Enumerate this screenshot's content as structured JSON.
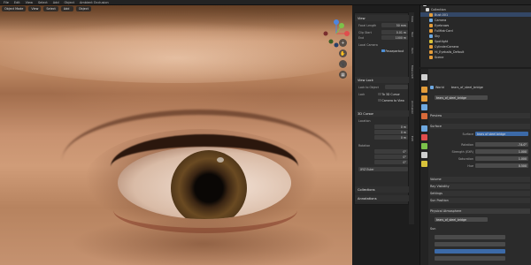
{
  "menubar": {
    "items": [
      "File",
      "Edit",
      "View",
      "Select",
      "Add",
      "Object",
      "Ambient Occlusion"
    ]
  },
  "viewport": {
    "header_buttons": [
      "Object Mode",
      "View",
      "Select",
      "Add",
      "Object"
    ],
    "nav_buttons": [
      "+",
      "✋",
      "🎥",
      "▦"
    ],
    "gizmo_axes": {
      "x": "#e04d4d",
      "y": "#7cc24a",
      "z": "#4d86e0"
    }
  },
  "npanel": {
    "sections": {
      "view": "View",
      "view_lock": "View Lock",
      "3d_cursor": "3D Cursor",
      "collections": "Collections",
      "annotations": "Annotations"
    },
    "view": {
      "focal_label": "Focal Length",
      "focal_value": "50 mm",
      "clip_start_label": "Clip Start",
      "clip_start_value": "0.01 m",
      "clip_end_label": "End",
      "clip_end_value": "1000 m",
      "local_camera_label": "Local Camera",
      "passepartout_label": "Passepartout"
    },
    "view_lock": {
      "object_label": "Lock to Object",
      "lock_label": "Lock",
      "to3d_label": "To 3D Cursor",
      "camera_label": "Camera to View"
    },
    "cursor": {
      "location_label": "Location",
      "x": "0 m",
      "y": "0 m",
      "z": "0 m",
      "rotation_label": "Rotation",
      "rx": "0°",
      "ry": "0°",
      "rz": "0°",
      "mode_label": "Rotation Mode",
      "mode_value": "XYZ Euler"
    },
    "vtabs": [
      "View",
      "Tool",
      "Item",
      "MeasureIt",
      "Animation",
      "Edit"
    ]
  },
  "outliner": {
    "rows": [
      {
        "label": "Scene Collection",
        "sel": false,
        "icon": "#d8d8d8"
      },
      {
        "label": "Collection",
        "sel": false,
        "icon": "#d8d8d8"
      },
      {
        "label": "Bust.001",
        "sel": true,
        "icon": "#e39c3a"
      },
      {
        "label": "Camera",
        "sel": false,
        "icon": "#6ea8e0"
      },
      {
        "label": "Eyebrows",
        "sel": false,
        "icon": "#e39c3a"
      },
      {
        "label": "FullHairCard",
        "sel": false,
        "icon": "#e39c3a"
      },
      {
        "label": "Sky",
        "sel": false,
        "icon": "#6ea8e0"
      },
      {
        "label": "Spotlight",
        "sel": false,
        "icon": "#d8c23a"
      },
      {
        "label": "CylinderCamera",
        "sel": false,
        "icon": "#e39c3a"
      },
      {
        "label": "Hi_Eyeballs_Default",
        "sel": false,
        "icon": "#e39c3a"
      },
      {
        "label": "Scene",
        "sel": false,
        "icon": "#e39c3a"
      }
    ]
  },
  "props": {
    "world_tab": "World",
    "world_name": "tears_of_steel_bridge",
    "world_field": "tears_of_steel_bridge",
    "sections": {
      "preview": "Preview",
      "surface": "Surface",
      "volume": "Volume",
      "ray_visibility": "Ray Visibility",
      "settings": "Settings",
      "sun_position": "Sun Position",
      "physical_atmosphere": "Physical Atmosphere"
    },
    "surface": {
      "surface_label": "Surface",
      "surface_value": "tears of steel bridge",
      "rotation_label": "Rotation",
      "rotation_value": "-74.0°",
      "strength_label": "Strength (EXR)",
      "strength_value": "1.000",
      "saturation_label": "Saturation",
      "saturation_value": "1.000",
      "hue_label": "Hue",
      "hue_value": "0.500"
    },
    "atmos_field": "tears_of_steel_bridge",
    "sun_label": "Sun",
    "tab_colors": [
      "#cfcfcf",
      "#e39c3a",
      "#e39c3a",
      "#6ea8e0",
      "#d86a3a",
      "#6ea8e0",
      "#e04d4d",
      "#7cc24a",
      "#cfcfcf",
      "#d8c23a"
    ]
  }
}
